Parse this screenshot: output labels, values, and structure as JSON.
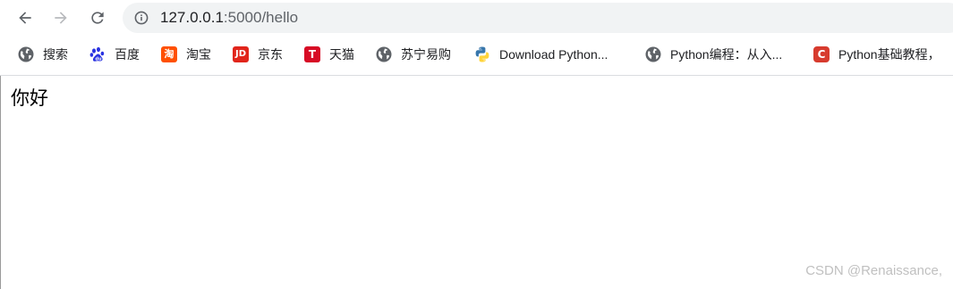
{
  "address_bar": {
    "host": "127.0.0.1",
    "path": ":5000/hello"
  },
  "bookmarks": [
    {
      "label": "搜索",
      "icon": "globe-icon"
    },
    {
      "label": "百度",
      "icon": "baidu-paw-icon"
    },
    {
      "label": "淘宝",
      "icon": "taobao-icon",
      "glyph": "淘"
    },
    {
      "label": "京东",
      "icon": "jd-icon",
      "glyph": "JD"
    },
    {
      "label": "天猫",
      "icon": "tmall-icon",
      "glyph": "T"
    },
    {
      "label": "苏宁易购",
      "icon": "globe-icon"
    },
    {
      "label": "Download Python...",
      "icon": "python-icon"
    },
    {
      "label": "Python编程：从入...",
      "icon": "globe-icon"
    },
    {
      "label": "Python基础教程，",
      "icon": "csdn-icon",
      "glyph": "C"
    }
  ],
  "page": {
    "body_text": "你好"
  },
  "watermark": "CSDN @Renaissance,",
  "colors": {
    "toolbar_bg": "#ffffff",
    "omnibox_bg": "#f1f3f4",
    "icon_gray": "#5f6368",
    "taobao": "#ff5000",
    "jd": "#e1251b",
    "tmall": "#d70b25",
    "csdn": "#d73b2e",
    "baidu": "#2932e1"
  }
}
